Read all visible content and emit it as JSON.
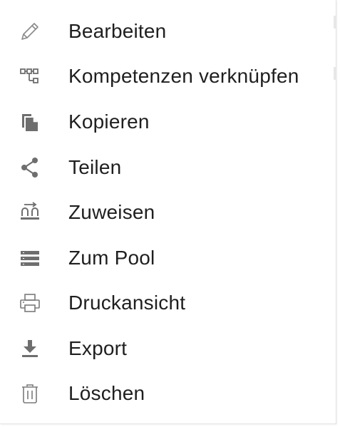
{
  "menu": {
    "items": [
      {
        "label": "Bearbeiten",
        "icon": "pencil-icon"
      },
      {
        "label": "Kompetenzen verknüpfen",
        "icon": "link-hierarchy-icon"
      },
      {
        "label": "Kopieren",
        "icon": "copy-icon"
      },
      {
        "label": "Teilen",
        "icon": "share-icon"
      },
      {
        "label": "Zuweisen",
        "icon": "assign-icon"
      },
      {
        "label": "Zum Pool",
        "icon": "pool-list-icon"
      },
      {
        "label": "Druckansicht",
        "icon": "printer-icon"
      },
      {
        "label": "Export",
        "icon": "download-icon"
      },
      {
        "label": "Löschen",
        "icon": "trash-icon"
      }
    ]
  },
  "colors": {
    "text": "#1f1f1f",
    "icon": "#757575",
    "border": "#e3e3e3",
    "background": "#ffffff"
  }
}
